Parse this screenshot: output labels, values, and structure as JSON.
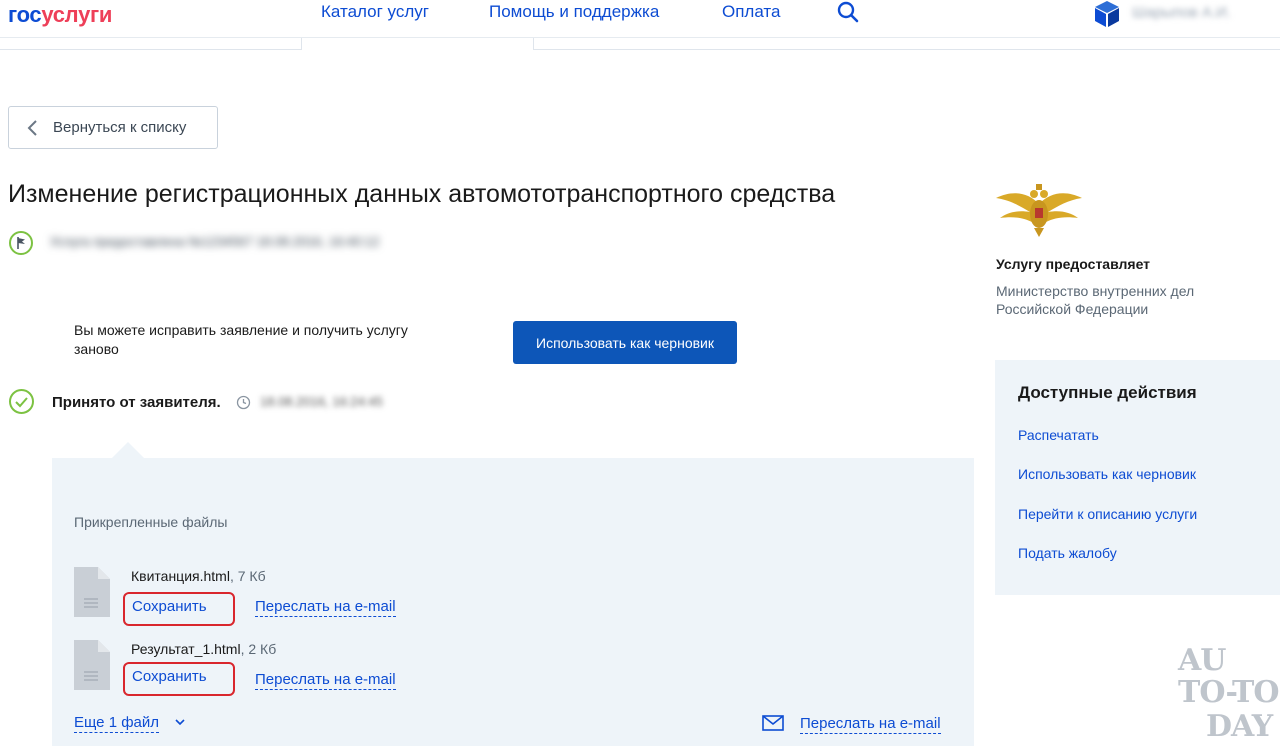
{
  "header": {
    "logo_part1": "гос",
    "logo_part2": "услуги",
    "nav": [
      "Каталог услуг",
      "Помощь и поддержка",
      "Оплата"
    ],
    "user_name": "Шарыпов А.И."
  },
  "back_button": "Вернуться к списку",
  "title": "Изменение регистрационных данных автомототранспортного средства",
  "status_blurred": "Услуга предоставлена   №1234567   18.08.2016, 16:40:12",
  "draft_prompt": "Вы можете исправить заявление и получить услугу заново",
  "draft_button": "Использовать как черновик",
  "accepted": {
    "label": "Принято от заявителя.",
    "time": "18.08.2016, 16:24:45"
  },
  "files": {
    "heading": "Прикрепленные файлы",
    "items": [
      {
        "name": "Квитанция.html",
        "size": ", 7 Кб",
        "save": "Сохранить",
        "email": "Переслать на e-mail"
      },
      {
        "name": "Результат_1.html",
        "size": ", 2 Кб",
        "save": "Сохранить",
        "email": "Переслать на e-mail"
      }
    ],
    "more": "Еще 1 файл",
    "email_all": "Переслать на e-mail"
  },
  "provider": {
    "label": "Услугу предоставляет",
    "name": "Министерство внутренних дел Российской Федерации"
  },
  "actions": {
    "title": "Доступные действия",
    "items": [
      "Распечатать",
      "Использовать как черновик",
      "Перейти к описанию услуги",
      "Подать жалобу"
    ]
  },
  "watermark": {
    "line1": "AU",
    "line2": "TO-TO",
    "line3": "DAY"
  },
  "colors": {
    "brand_blue": "#0d4cd3",
    "brand_red": "#ee3f58",
    "button_blue": "#0d56b8",
    "highlight_red": "#d9262d",
    "panel_bg": "#eef4f9",
    "check_green": "#7cc242"
  }
}
